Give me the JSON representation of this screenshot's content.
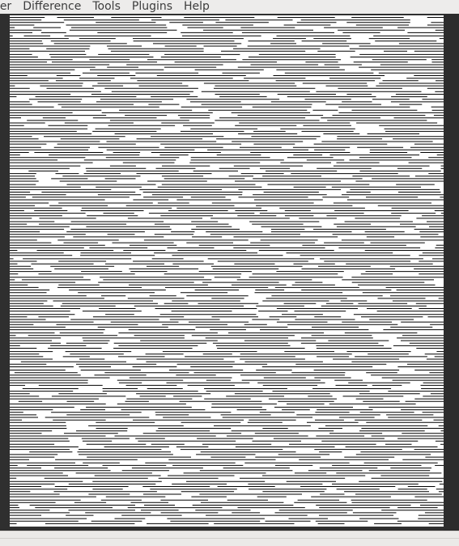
{
  "menubar": {
    "items": [
      "fier",
      "Difference",
      "Tools",
      "Plugins",
      "Help"
    ]
  },
  "colors": {
    "canvas_bg": "#ffffff",
    "stroke": "#000000",
    "workspace_bg": "#2f2f2f",
    "menu_bg": "#edeceb"
  }
}
